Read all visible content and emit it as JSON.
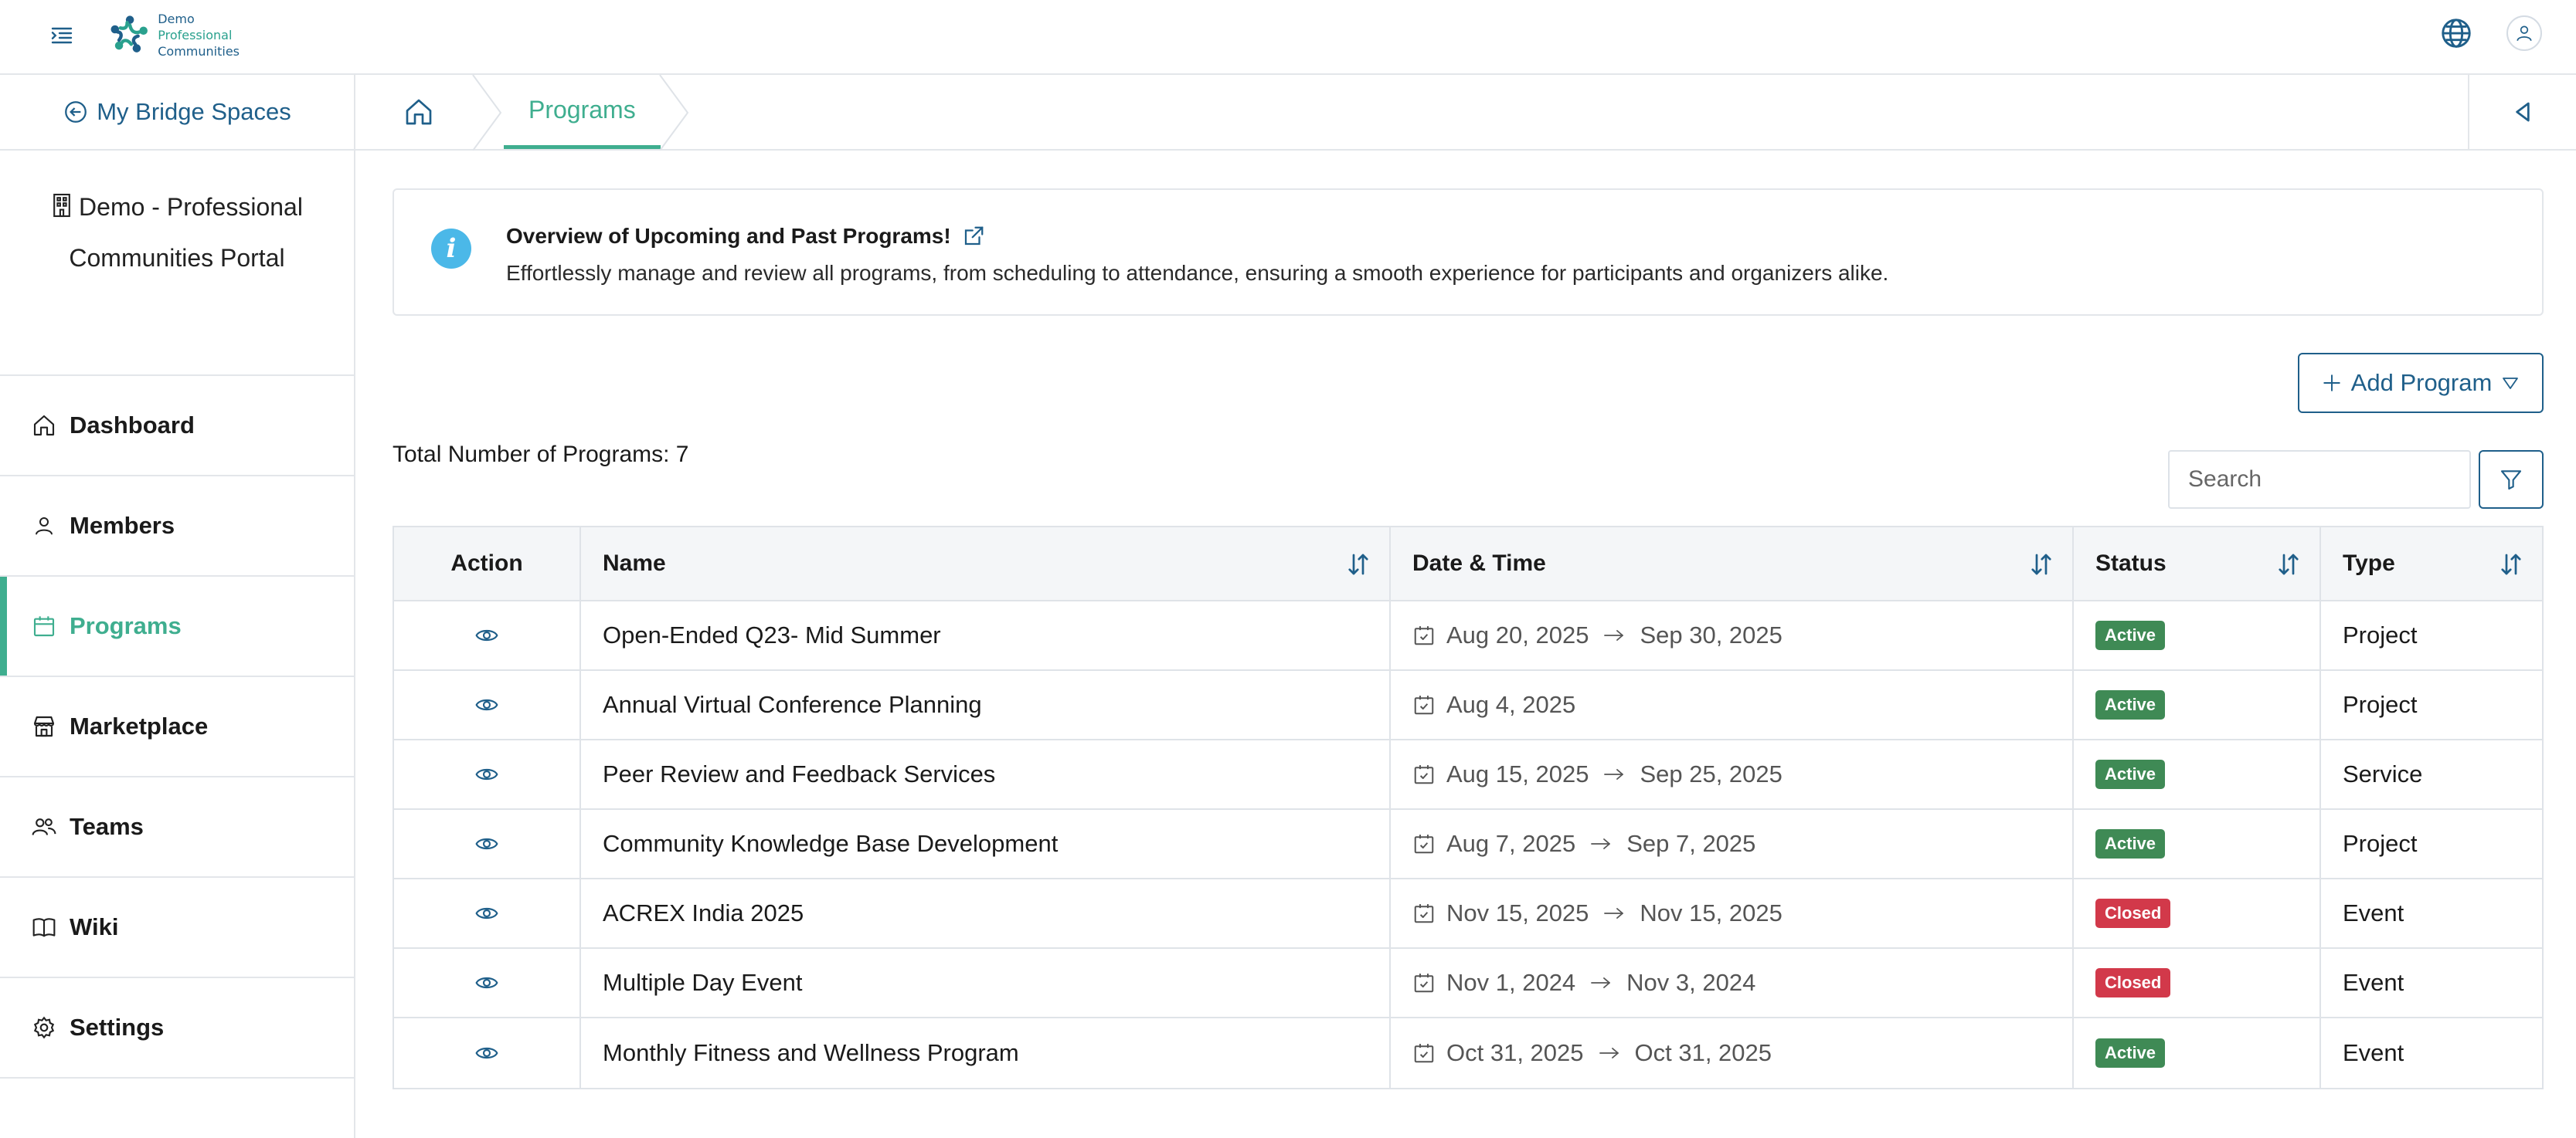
{
  "header": {
    "logo_line1": "Demo",
    "logo_line2": "Professional",
    "logo_line3": "Communities",
    "icons": [
      "menu-toggle-icon",
      "globe-icon",
      "user-icon"
    ]
  },
  "sidebar": {
    "back_label": "My Bridge Spaces",
    "org_line1": "Demo - Professional",
    "org_line2": "Communities Portal",
    "items": [
      {
        "label": "Dashboard",
        "icon": "home-icon",
        "active": false
      },
      {
        "label": "Members",
        "icon": "person-icon",
        "active": false
      },
      {
        "label": "Programs",
        "icon": "calendar-icon",
        "active": true
      },
      {
        "label": "Marketplace",
        "icon": "store-icon",
        "active": false
      },
      {
        "label": "Teams",
        "icon": "people-icon",
        "active": false
      },
      {
        "label": "Wiki",
        "icon": "book-icon",
        "active": false
      },
      {
        "label": "Settings",
        "icon": "gear-icon",
        "active": false
      }
    ]
  },
  "breadcrumb": {
    "current": "Programs"
  },
  "info": {
    "title": "Overview of Upcoming and Past Programs!",
    "description": "Effortlessly manage and review all programs, from scheduling to attendance, ensuring a smooth experience for participants and organizers alike."
  },
  "toolbar": {
    "add_label": "Add Program",
    "total_label": "Total Number of Programs: 7",
    "search_placeholder": "Search"
  },
  "table": {
    "headers": {
      "action": "Action",
      "name": "Name",
      "date": "Date & Time",
      "status": "Status",
      "type": "Type"
    },
    "rows": [
      {
        "name": "Open-Ended Q23- Mid Summer",
        "start": "Aug 20, 2025",
        "end": "Sep 30, 2025",
        "status": "Active",
        "type": "Project"
      },
      {
        "name": "Annual Virtual Conference Planning",
        "start": "Aug 4, 2025",
        "end": "",
        "status": "Active",
        "type": "Project"
      },
      {
        "name": "Peer Review and Feedback Services",
        "start": "Aug 15, 2025",
        "end": "Sep 25, 2025",
        "status": "Active",
        "type": "Service"
      },
      {
        "name": "Community Knowledge Base Development",
        "start": "Aug 7, 2025",
        "end": "Sep 7, 2025",
        "status": "Active",
        "type": "Project"
      },
      {
        "name": "ACREX India 2025",
        "start": "Nov 15, 2025",
        "end": "Nov 15, 2025",
        "status": "Closed",
        "type": "Event"
      },
      {
        "name": "Multiple Day Event",
        "start": "Nov 1, 2024",
        "end": "Nov 3, 2024",
        "status": "Closed",
        "type": "Event"
      },
      {
        "name": "Monthly Fitness and Wellness Program",
        "start": "Oct 31, 2025",
        "end": "Oct 31, 2025",
        "status": "Active",
        "type": "Event"
      }
    ]
  },
  "colors": {
    "brand": "#1f5f8a",
    "accent": "#3fae8f",
    "active": "#3f8a55",
    "closed": "#d2394a",
    "info": "#4bb8e8"
  }
}
